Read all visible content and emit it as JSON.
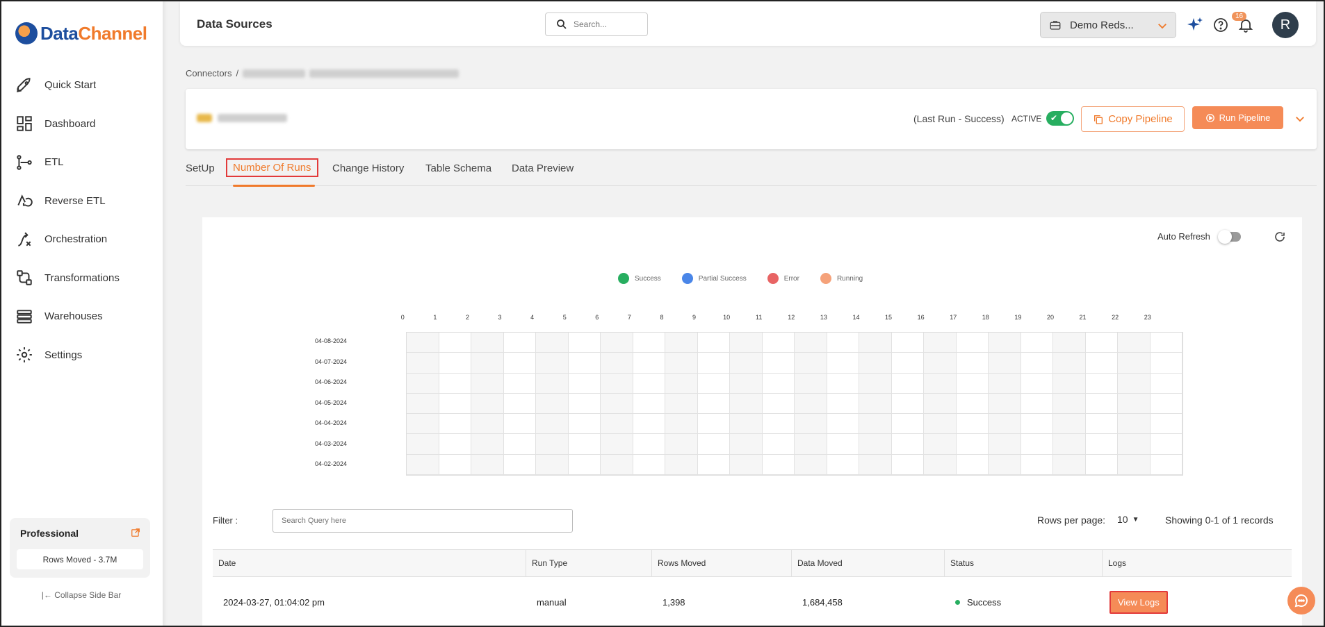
{
  "brand": {
    "part1": "Data",
    "part2": "Channel",
    "logo_icon": "datachannel-logo"
  },
  "sidebar": {
    "items": [
      {
        "label": "Quick Start",
        "icon": "rocket-icon"
      },
      {
        "label": "Dashboard",
        "icon": "dashboard-icon"
      },
      {
        "label": "ETL",
        "icon": "etl-icon"
      },
      {
        "label": "Reverse ETL",
        "icon": "reverse-etl-icon"
      },
      {
        "label": "Orchestration",
        "icon": "orchestration-icon"
      },
      {
        "label": "Transformations",
        "icon": "transformations-icon"
      },
      {
        "label": "Warehouses",
        "icon": "warehouses-icon"
      },
      {
        "label": "Settings",
        "icon": "gear-icon"
      }
    ],
    "plan": {
      "title": "Professional",
      "rows_moved": "Rows Moved - 3.7M"
    },
    "collapse_label": "Collapse Side Bar"
  },
  "header": {
    "title": "Data Sources",
    "search_placeholder": "Search...",
    "workspace": "Demo Reds...",
    "notification_count": "16",
    "avatar_initial": "R"
  },
  "breadcrumb": {
    "root": "Connectors",
    "separator": "/"
  },
  "pipeline": {
    "last_run": "(Last Run - Success)",
    "active_label": "ACTIVE",
    "copy_button": "Copy Pipeline",
    "run_button": "Run Pipeline"
  },
  "tabs": [
    {
      "label": "SetUp"
    },
    {
      "label": "Number Of Runs",
      "active": true
    },
    {
      "label": "Change History"
    },
    {
      "label": "Table Schema"
    },
    {
      "label": "Data Preview"
    }
  ],
  "runs": {
    "auto_refresh_label": "Auto Refresh",
    "auto_refresh_on": false,
    "legend": [
      {
        "label": "Success",
        "color": "#27ae60"
      },
      {
        "label": "Partial Success",
        "color": "#4a86e8"
      },
      {
        "label": "Error",
        "color": "#e86464"
      },
      {
        "label": "Running",
        "color": "#f5a27a"
      }
    ],
    "hours": [
      "0",
      "1",
      "2",
      "3",
      "4",
      "5",
      "6",
      "7",
      "8",
      "9",
      "10",
      "11",
      "12",
      "13",
      "14",
      "15",
      "16",
      "17",
      "18",
      "19",
      "20",
      "21",
      "22",
      "23"
    ],
    "days": [
      "04-08-2024",
      "04-07-2024",
      "04-06-2024",
      "04-05-2024",
      "04-04-2024",
      "04-03-2024",
      "04-02-2024"
    ],
    "filter_label": "Filter :",
    "filter_placeholder": "Search Query here",
    "rows_per_page_label": "Rows per page:",
    "rows_per_page": "10",
    "showing": "Showing 0-1 of 1 records"
  },
  "table": {
    "columns": [
      "Date",
      "Run Type",
      "Rows Moved",
      "Data Moved",
      "Status",
      "Logs"
    ],
    "rows": [
      {
        "date": "2024-03-27, 01:04:02 pm",
        "run_type": "manual",
        "rows_moved": "1,398",
        "data_moved": "1,684,458",
        "status": "Success",
        "logs_button": "View Logs"
      }
    ]
  }
}
